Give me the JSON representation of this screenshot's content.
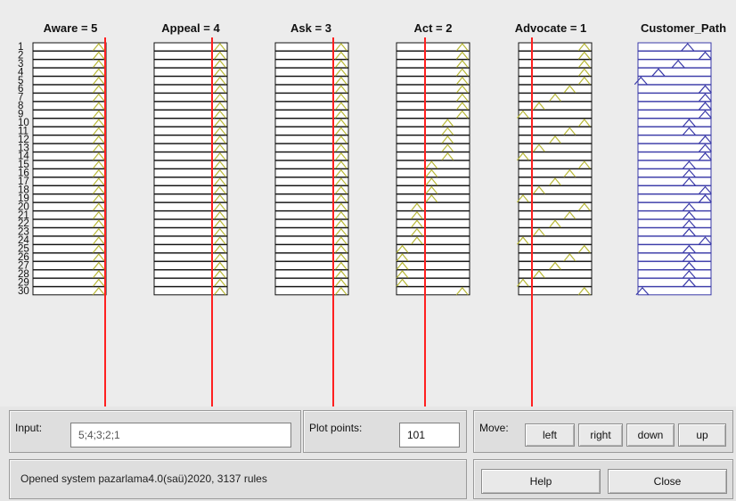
{
  "columns": [
    {
      "label": "Aware = 5",
      "color": "#1a1a1a"
    },
    {
      "label": "Appeal = 4",
      "color": "#1a1a1a"
    },
    {
      "label": "Ask = 3",
      "color": "#1a1a1a"
    },
    {
      "label": "Act = 2",
      "color": "#1a1a1a"
    },
    {
      "label": "Advocate = 1",
      "color": "#1a1a1a"
    },
    {
      "label": "Customer_Path",
      "color": "#3a3aa8"
    }
  ],
  "row_labels": [
    "1",
    "2",
    "3",
    "4",
    "5",
    "6",
    "7",
    "8",
    "9",
    "10",
    "11",
    "12",
    "13",
    "14",
    "15",
    "16",
    "17",
    "18",
    "19",
    "20",
    "21",
    "22",
    "23",
    "24",
    "25",
    "26",
    "27",
    "28",
    "29",
    "30"
  ],
  "input": {
    "label": "Input:",
    "value": "5;4;3;2;1"
  },
  "plot_points": {
    "label": "Plot points:",
    "value": "101"
  },
  "move": {
    "label": "Move:",
    "buttons": [
      "left",
      "right",
      "down",
      "up"
    ]
  },
  "status_text": "Opened system pazarlama4.0(saü)2020, 3137 rules",
  "help_label": "Help",
  "close_label": "Close",
  "colors": {
    "input_line": "#ff2020",
    "mf_triangle": "#b8b838",
    "output_mf": "#3a3aa8",
    "box_border": "#111111"
  }
}
